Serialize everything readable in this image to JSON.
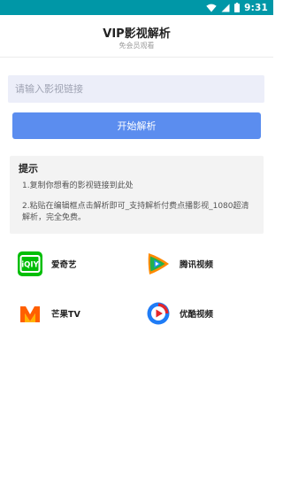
{
  "status_bar": {
    "time": "9:31",
    "bg_color": "#0097a7",
    "icons": [
      "wifi-icon",
      "signal-icon",
      "battery-icon"
    ]
  },
  "header": {
    "title": "VIP影视解析",
    "subtitle": "免会员观看"
  },
  "search": {
    "placeholder": "请输入影视链接",
    "value": ""
  },
  "parse_button": {
    "label": "开始解析",
    "color": "#5b8def"
  },
  "tips": {
    "title": "提示",
    "items": [
      "1.复制你想看的影视链接到此处",
      "2.粘贴在编辑框点击解析即可_支持解析付费点播影视_1080超清解析，完全免费。"
    ]
  },
  "platforms": [
    {
      "name": "爱奇艺",
      "icon": "iqiyi-logo-icon",
      "color": "#00be06"
    },
    {
      "name": "腾讯视频",
      "icon": "tencent-video-logo-icon",
      "color": "#ff8a00"
    },
    {
      "name": "芒果TV",
      "icon": "mango-tv-logo-icon",
      "color": "#ff5f00"
    },
    {
      "name": "优酷视频",
      "icon": "youku-logo-icon",
      "color": "#1f7cf6"
    }
  ]
}
